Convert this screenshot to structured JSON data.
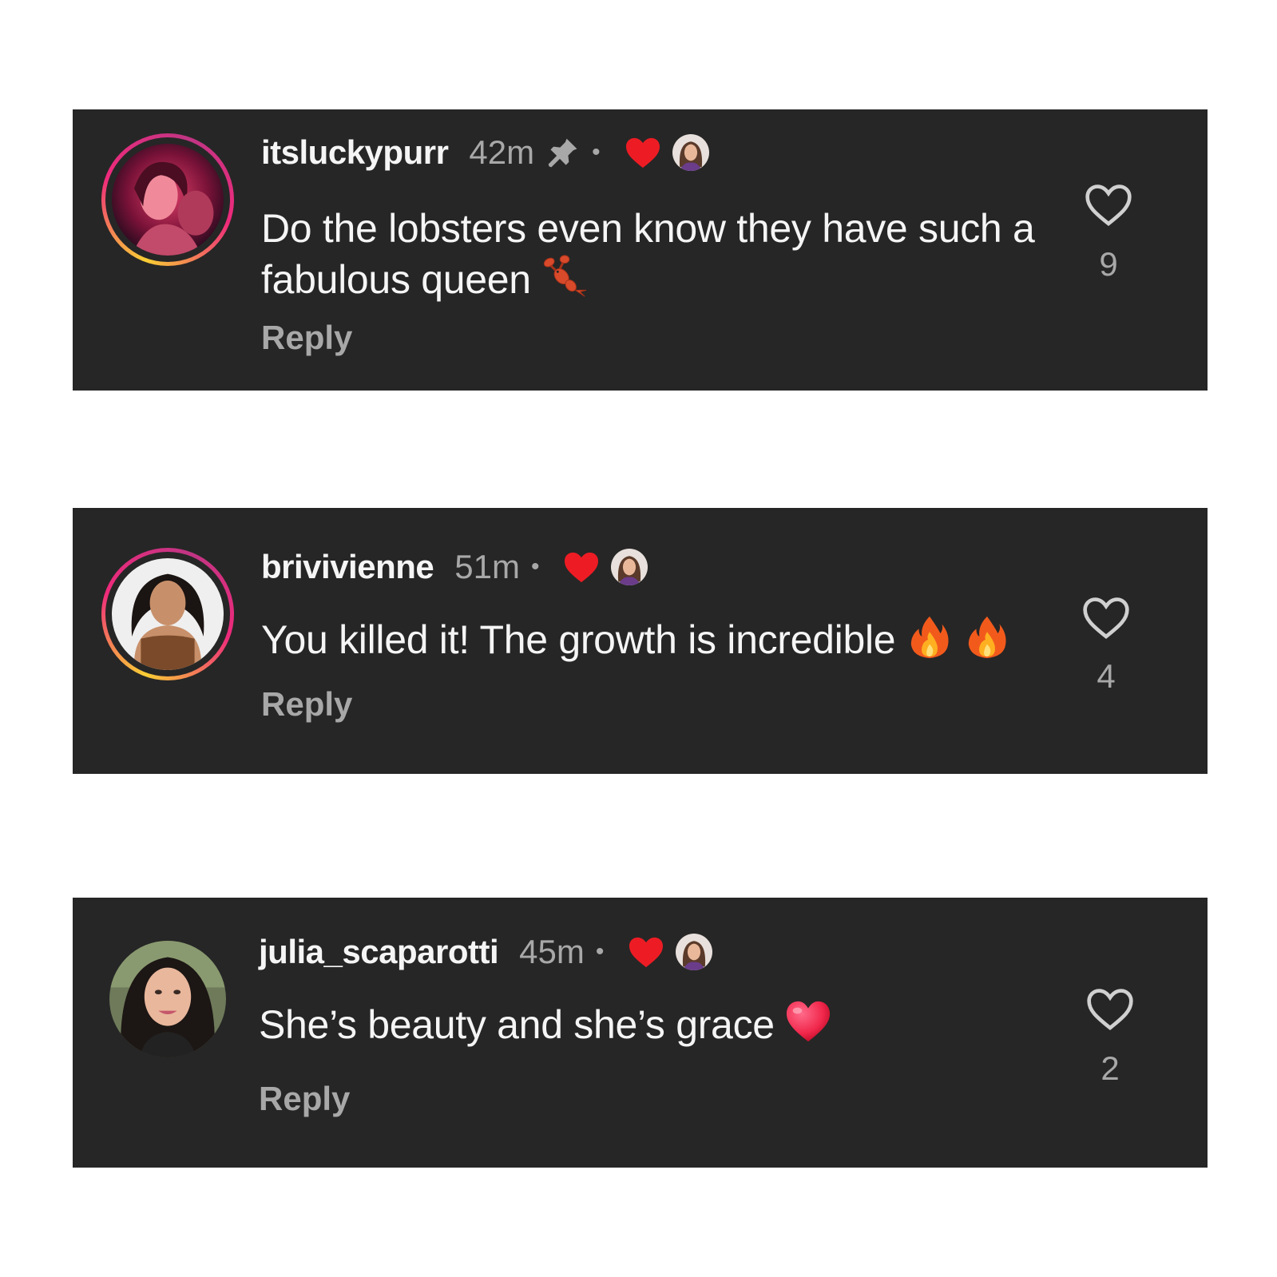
{
  "colors": {
    "card_background": "#262626",
    "primary_text": "#f5f5f5",
    "secondary_text": "#a8a8a8",
    "creator_heart": "#ed1c24",
    "story_ring": [
      "#f9ce34",
      "#ee2a7b",
      "#c13584"
    ]
  },
  "comments": [
    {
      "username": "itsluckypurr",
      "time": "42m",
      "pinned": true,
      "separator": "•",
      "liked_by_creator": true,
      "text": "Do the lobsters even know they have such a fabulous queen",
      "emoji": "lobster",
      "reply_label": "Reply",
      "like_count": "9",
      "has_story_ring": true
    },
    {
      "username": "brivivienne",
      "time": "51m",
      "pinned": false,
      "separator": "•",
      "liked_by_creator": true,
      "text": "You killed it! The growth is incredible",
      "emoji": "fire fire",
      "reply_label": "Reply",
      "like_count": "4",
      "has_story_ring": true
    },
    {
      "username": "julia_scaparotti",
      "time": "45m",
      "pinned": false,
      "separator": "•",
      "liked_by_creator": true,
      "text": "She’s beauty and she’s grace",
      "emoji": "heart",
      "reply_label": "Reply",
      "like_count": "2",
      "has_story_ring": false
    }
  ]
}
